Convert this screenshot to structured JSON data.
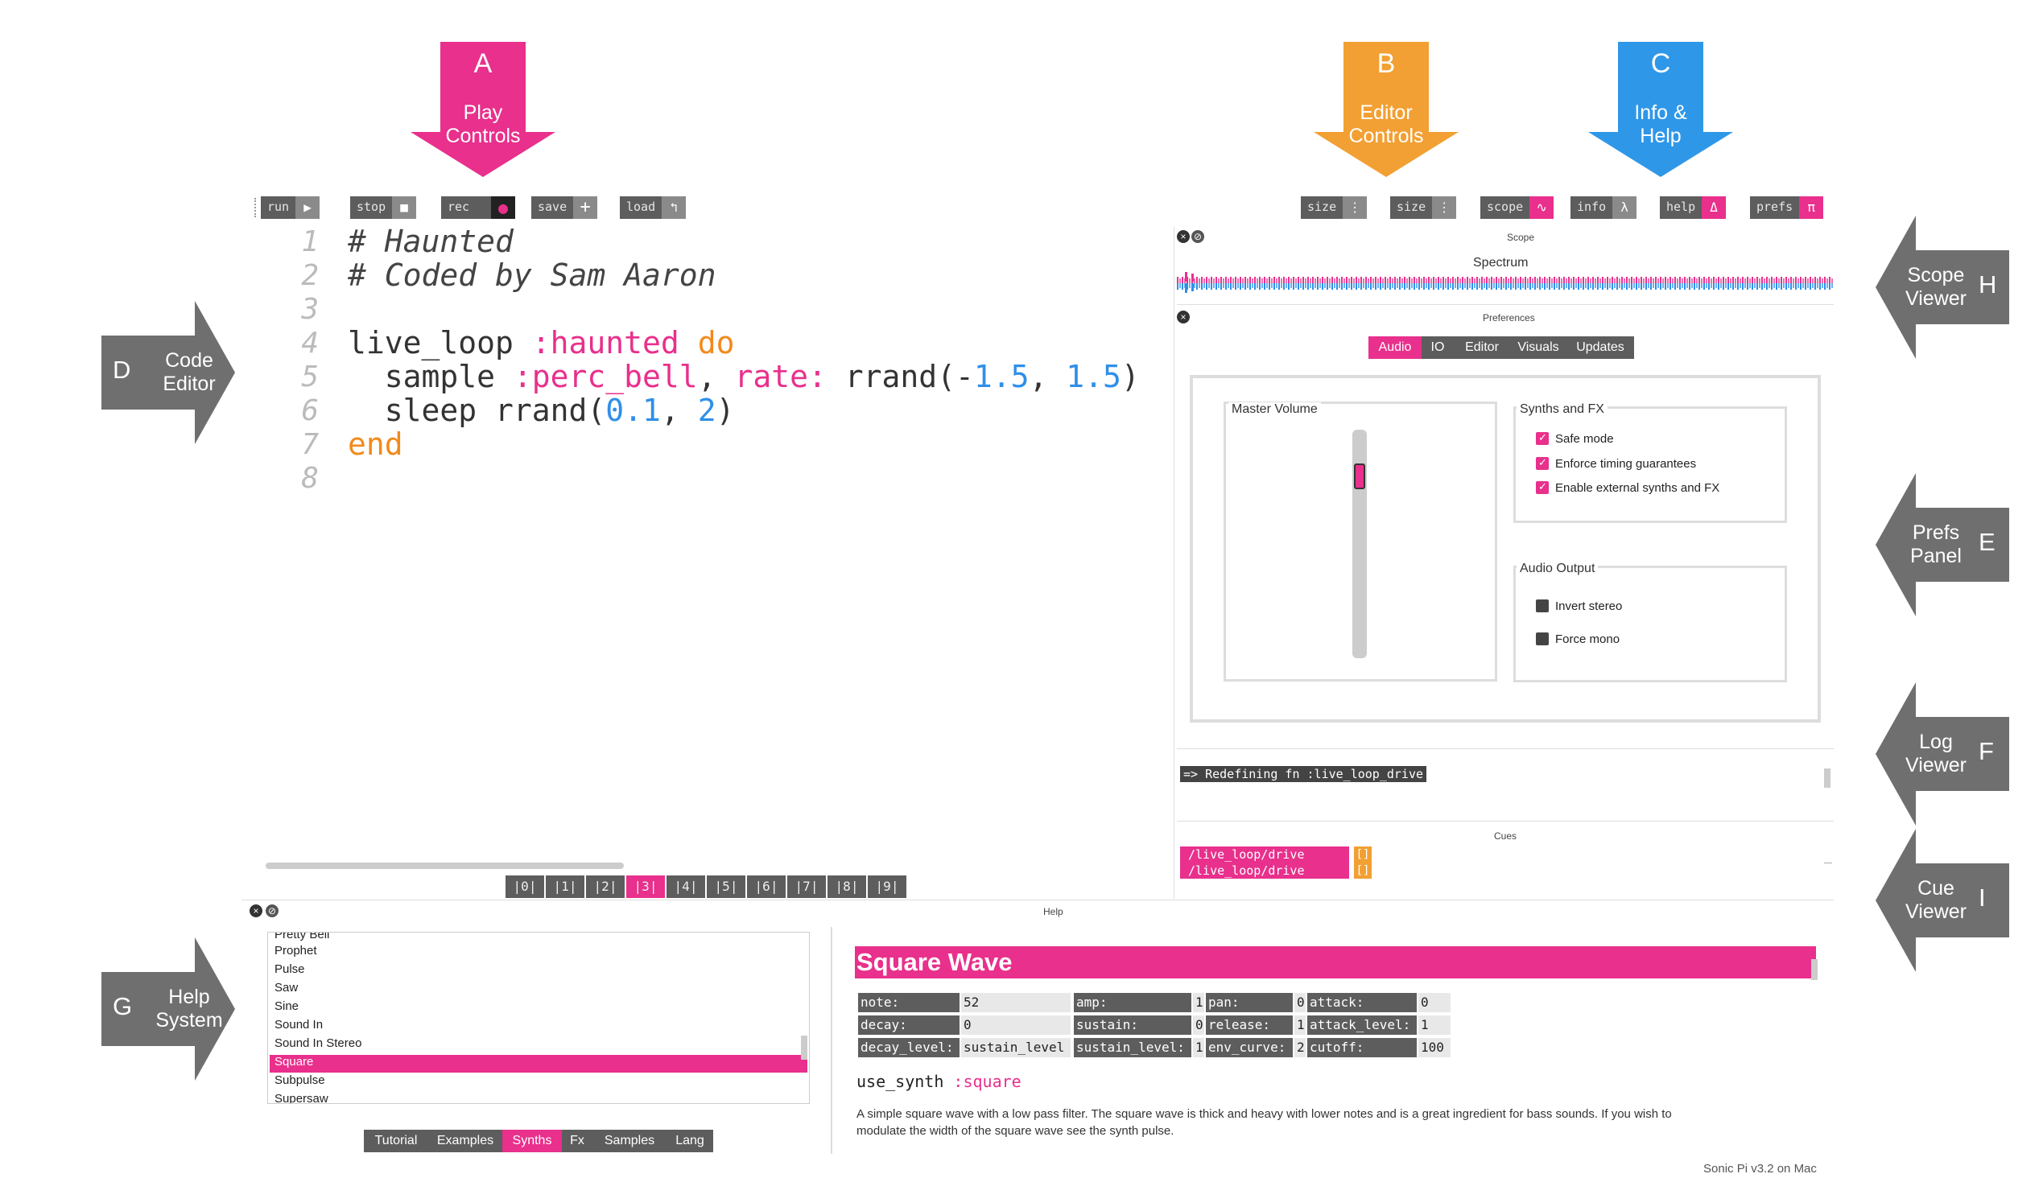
{
  "annotations": {
    "top": [
      {
        "letter": "A",
        "label_line1": "Play",
        "label_line2": "Controls",
        "color": "#e8308c"
      },
      {
        "letter": "B",
        "label_line1": "Editor",
        "label_line2": "Controls",
        "color": "#f2a033"
      },
      {
        "letter": "C",
        "label_line1": "Info &",
        "label_line2": "Help",
        "color": "#2f97e8"
      }
    ],
    "left": [
      {
        "letter": "D",
        "label_line1": "Code",
        "label_line2": "Editor"
      },
      {
        "letter": "G",
        "label_line1": "Help",
        "label_line2": "System"
      }
    ],
    "right": [
      {
        "letter": "H",
        "label_line1": "Scope",
        "label_line2": "Viewer"
      },
      {
        "letter": "E",
        "label_line1": "Prefs",
        "label_line2": "Panel"
      },
      {
        "letter": "F",
        "label_line1": "Log",
        "label_line2": "Viewer"
      },
      {
        "letter": "I",
        "label_line1": "Cue",
        "label_line2": "Viewer"
      }
    ]
  },
  "toolbar": {
    "play": [
      {
        "label": "run",
        "icon": "play-icon",
        "glyph": "▶"
      },
      {
        "label": "stop",
        "icon": "stop-icon",
        "glyph": "■"
      },
      {
        "label": "rec",
        "icon": "record-icon",
        "glyph": "●"
      },
      {
        "label": "save",
        "icon": "plus-icon",
        "glyph": "+"
      },
      {
        "label": "load",
        "icon": "load-icon",
        "glyph": "↰"
      }
    ],
    "editor": [
      {
        "label": "size",
        "icon": "size-down-icon",
        "glyph": "⋮"
      },
      {
        "label": "size",
        "icon": "size-up-icon",
        "glyph": "⋮"
      },
      {
        "label": "scope",
        "icon": "scope-icon",
        "glyph": "∿"
      }
    ],
    "info": [
      {
        "label": "info",
        "icon": "lambda-icon",
        "glyph": "λ"
      },
      {
        "label": "help",
        "icon": "delta-icon",
        "glyph": "Δ"
      },
      {
        "label": "prefs",
        "icon": "pi-icon",
        "glyph": "π"
      }
    ]
  },
  "editor": {
    "line_numbers": [
      "1",
      "2",
      "3",
      "4",
      "5",
      "6",
      "7",
      "8"
    ],
    "line1": "# Haunted",
    "line2": "# Coded by Sam Aaron",
    "line4_a": "live_loop ",
    "line4_b": ":haunted",
    "line4_c": " do",
    "line5_a": "  sample ",
    "line5_b": ":perc_bell",
    "line5_c": ", ",
    "line5_d": "rate:",
    "line5_e": " rrand(-",
    "line5_f": "1.5",
    "line5_g": ", ",
    "line5_h": "1.5",
    "line5_i": ")",
    "line6_a": "  sleep rrand(",
    "line6_b": "0.1",
    "line6_c": ", ",
    "line6_d": "2",
    "line6_e": ")",
    "line7": "end",
    "buffers": [
      "|0|",
      "|1|",
      "|2|",
      "|3|",
      "|4|",
      "|5|",
      "|6|",
      "|7|",
      "|8|",
      "|9|"
    ],
    "active_buffer": 3
  },
  "scope": {
    "title": "Scope",
    "label": "Spectrum"
  },
  "prefs": {
    "title": "Preferences",
    "tabs": [
      "Audio",
      "IO",
      "Editor",
      "Visuals",
      "Updates"
    ],
    "active_tab": "Audio",
    "master_volume_label": "Master Volume",
    "synths_fx_label": "Synths and FX",
    "safe_mode": "Safe mode",
    "enforce_timing": "Enforce timing guarantees",
    "enable_external": "Enable external synths and FX",
    "audio_output_label": "Audio Output",
    "invert_stereo": "Invert stereo",
    "force_mono": "Force mono"
  },
  "log": {
    "line": "=> Redefining fn :live_loop_drive"
  },
  "cues": {
    "title": "Cues",
    "items": [
      "/live_loop/drive",
      "/live_loop/drive"
    ],
    "values": [
      "[]",
      "[]"
    ]
  },
  "help": {
    "title": "Help",
    "list": [
      "Pretty Bell",
      "Prophet",
      "Pulse",
      "Saw",
      "Sine",
      "Sound In",
      "Sound In Stereo",
      "Square",
      "Subpulse",
      "Supersaw"
    ],
    "selected": "Square",
    "tabs": [
      "Tutorial",
      "Examples",
      "Synths",
      "Fx",
      "Samples",
      "Lang"
    ],
    "active_tab": "Synths",
    "heading": "Square Wave",
    "params": [
      [
        "note:",
        "52",
        "amp:",
        "1",
        "pan:",
        "0",
        "attack:",
        "0"
      ],
      [
        "decay:",
        "0",
        "sustain:",
        "0",
        "release:",
        "1",
        "attack_level:",
        "1"
      ],
      [
        "decay_level:",
        "sustain_level",
        "sustain_level:",
        "1",
        "env_curve:",
        "2",
        "cutoff:",
        "100"
      ]
    ],
    "use_synth_a": "use_synth ",
    "use_synth_b": ":square",
    "desc_line1": "A simple square wave with a low pass filter. The square wave is thick and heavy with lower notes and is a great ingredient for bass sounds. If you wish to",
    "desc_line2": "modulate the width of the square wave see the synth pulse.",
    "version": "Sonic Pi v3.2 on Mac"
  }
}
